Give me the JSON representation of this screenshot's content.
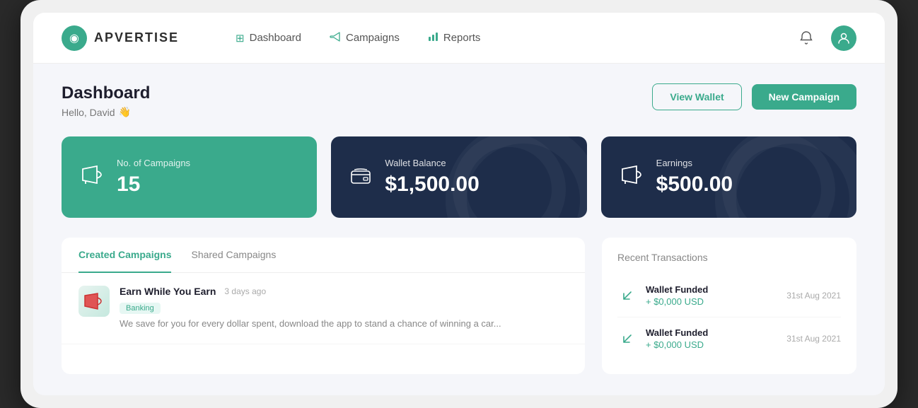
{
  "brand": {
    "name": "APVERTISE",
    "logo_icon": "◉"
  },
  "navbar": {
    "links": [
      {
        "id": "dashboard",
        "label": "Dashboard",
        "icon": "⊞"
      },
      {
        "id": "campaigns",
        "label": "Campaigns",
        "icon": "▷"
      },
      {
        "id": "reports",
        "label": "Reports",
        "icon": "📊"
      }
    ]
  },
  "header": {
    "title": "Dashboard",
    "subtitle": "Hello, David",
    "greeting_emoji": "👋",
    "view_wallet_label": "View Wallet",
    "new_campaign_label": "New Campaign"
  },
  "stats": [
    {
      "id": "campaigns",
      "label": "No. of Campaigns",
      "value": "15",
      "icon": "📢",
      "theme": "green"
    },
    {
      "id": "wallet",
      "label": "Wallet Balance",
      "value": "$1,500.00",
      "icon": "💳",
      "theme": "dark"
    },
    {
      "id": "earnings",
      "label": "Earnings",
      "value": "$500.00",
      "icon": "📢",
      "theme": "dark"
    }
  ],
  "campaigns_panel": {
    "tabs": [
      {
        "id": "created",
        "label": "Created Campaigns",
        "active": true
      },
      {
        "id": "shared",
        "label": "Shared Campaigns",
        "active": false
      }
    ],
    "items": [
      {
        "id": "campaign-1",
        "name": "Earn While You Earn",
        "time": "3 days ago",
        "badge": "Banking",
        "description": "We save for you for every dollar spent, download the app to stand a chance of winning a car...",
        "thumb_icon": "📌"
      }
    ]
  },
  "transactions_panel": {
    "title": "Recent Transactions",
    "items": [
      {
        "id": "tx-1",
        "label": "Wallet Funded",
        "amount": "+ $0,000 USD",
        "date": "31st Aug 2021",
        "icon": "↙"
      },
      {
        "id": "tx-2",
        "label": "Wallet Funded",
        "amount": "+ $0,000 USD",
        "date": "31st Aug 2021",
        "icon": "↙"
      }
    ]
  }
}
